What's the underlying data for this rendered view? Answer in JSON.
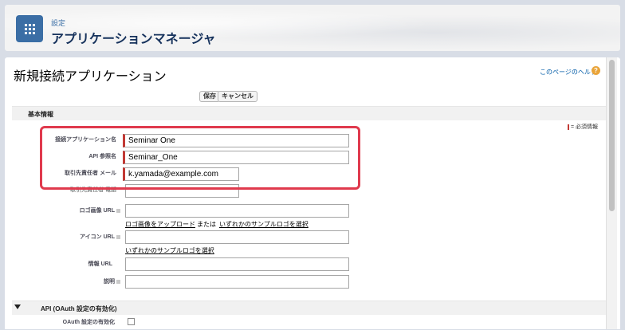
{
  "header": {
    "subtitle": "設定",
    "title": "アプリケーションマネージャ",
    "app_icon": "app-launcher-grid-icon"
  },
  "page": {
    "title": "新規接続アプリケーション",
    "help_link": "このページのヘルプ",
    "help_icon": "?"
  },
  "toolbar": {
    "save_label": "保存",
    "cancel_label": "キャンセル"
  },
  "basic_info": {
    "section_title": "基本情報",
    "required_legend": "= 必須情報",
    "fields": {
      "app_name": {
        "label": "接続アプリケーション名",
        "value": "Seminar One"
      },
      "api_name": {
        "label": "API 参照名",
        "value": "Seminar_One"
      },
      "contact_email": {
        "label": "取引先責任者 メール",
        "value": "k.yamada@example.com"
      },
      "contact_phone": {
        "label": "取引先責任者 電話",
        "value": ""
      },
      "logo_url": {
        "label": "ロゴ画像 URL",
        "value": ""
      },
      "icon_url": {
        "label": "アイコン URL",
        "value": ""
      },
      "info_url": {
        "label": "情報 URL",
        "value": ""
      },
      "description": {
        "label": "説明",
        "value": ""
      }
    },
    "logo_links": {
      "upload": "ロゴ画像をアップロード",
      "or": "または",
      "sample": "いずれかのサンプルロゴを選択"
    },
    "icon_links": {
      "sample": "いずれかのサンプルロゴを選択"
    }
  },
  "api_section": {
    "section_title": "API (OAuth 設定の有効化)",
    "oauth_label": "OAuth 設定の有効化",
    "oauth_checked": false
  },
  "colors": {
    "required": "#c23934",
    "highlight": "#e03a4d",
    "link": "#015ba7",
    "app_icon_bg": "#3b6ea5"
  }
}
